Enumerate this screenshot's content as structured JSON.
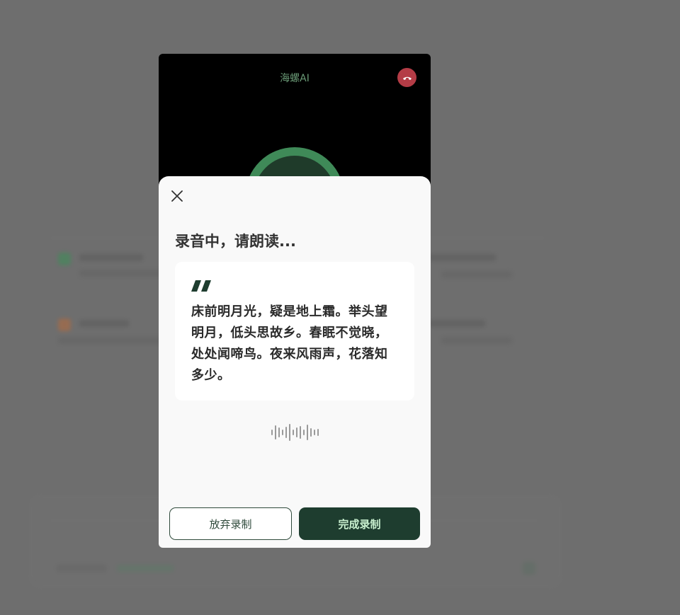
{
  "call": {
    "title": "海螺AI"
  },
  "recording": {
    "title": "录音中，请朗读...",
    "poem": "床前明月光，疑是地上霜。举头望明月，低头思故乡。春眠不觉晓，处处闻啼鸟。夜来风雨声，花落知多少。",
    "discard_label": "放弃录制",
    "finish_label": "完成录制"
  },
  "colors": {
    "accent_dark": "#1e3d2f",
    "accent_text": "#c9f0cf",
    "hangup": "#b43c46",
    "title_green": "#6a9a76"
  },
  "icons": {
    "close": "close-icon",
    "hangup": "phone-hangup-icon",
    "quote": "quote-icon",
    "waveform": "waveform-icon"
  }
}
